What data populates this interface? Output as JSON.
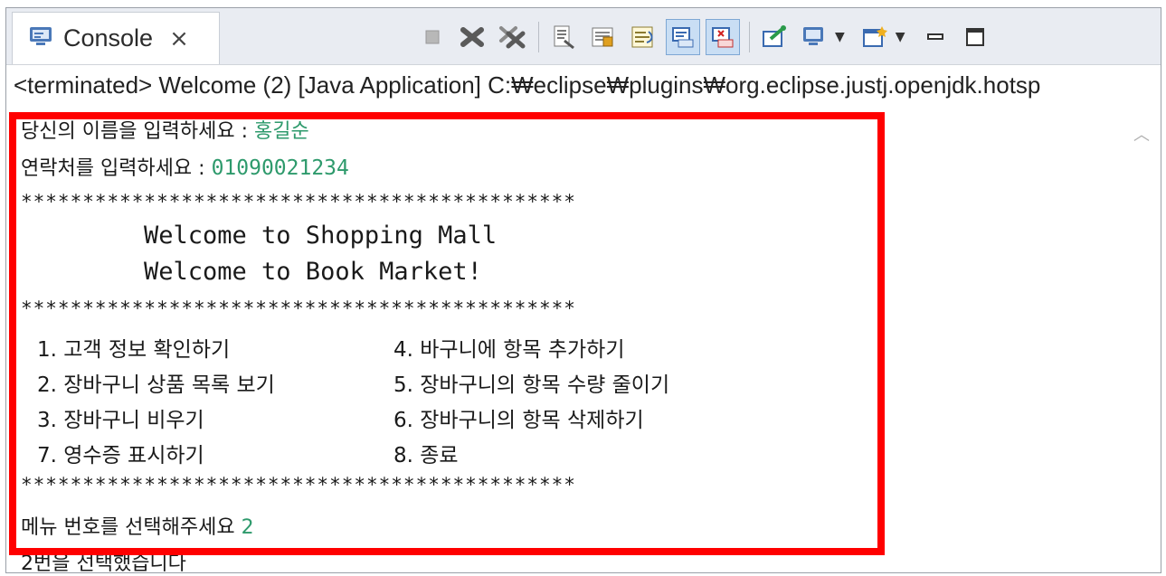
{
  "tab": {
    "label": "Console",
    "icon": "console-icon",
    "close_glyph": "×"
  },
  "toolbar": {
    "buttons": [
      "terminate-icon",
      "remove-launch-icon",
      "remove-all-terminated-icon",
      "clear-console-icon",
      "scroll-lock-icon",
      "word-wrap-icon",
      "show-console-on-stdout-icon",
      "show-console-on-stderr-icon",
      "pin-console-icon",
      "display-selected-console-icon",
      "open-console-icon",
      "minimize-icon",
      "maximize-icon"
    ]
  },
  "process_line": "<terminated> Welcome (2) [Java Application] C:₩eclipse₩plugins₩org.eclipse.justj.openjdk.hotsp",
  "output": {
    "name_prompt": "당신의 이름을 입력하세요 : ",
    "name_value": "홍길순",
    "phone_prompt": "연락처를 입력하세요 : ",
    "phone_value": "01090021234",
    "stars": "*********************************************",
    "welcome1": "Welcome to Shopping Mall",
    "welcome2": "Welcome to Book Market!",
    "menu": [
      [
        "1. 고객 정보 확인하기",
        "4. 바구니에 항목 추가하기"
      ],
      [
        "2. 장바구니 상품 목록 보기",
        "5. 장바구니의 항목 수량 줄이기"
      ],
      [
        "3. 장바구니 비우기",
        "6. 장바구니의 항목 삭제하기"
      ],
      [
        "7. 영수증 표시하기",
        "8. 종료"
      ]
    ],
    "menu_prompt": "메뉴 번호를 선택해주세요 ",
    "menu_value": "2",
    "result": "2번을 선택했습니다"
  },
  "colors": {
    "input_text": "#2e9a6c",
    "highlight_box": "#ff0000",
    "pressed_button": "#c9def4"
  }
}
